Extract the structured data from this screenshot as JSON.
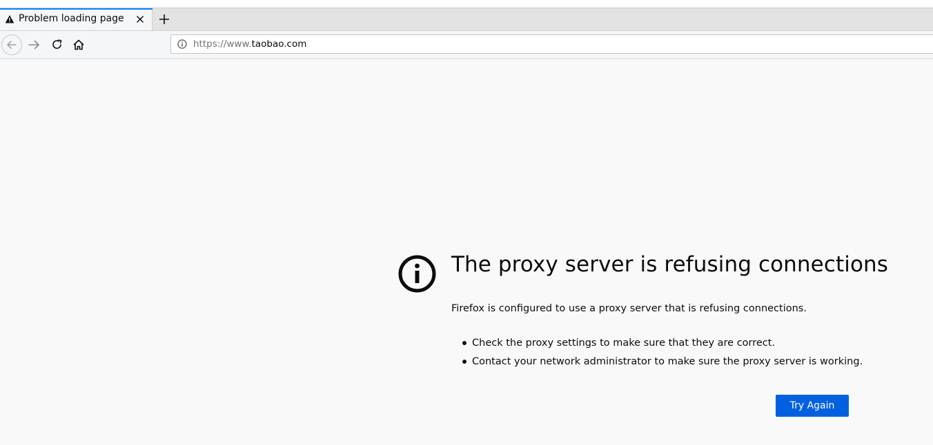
{
  "tab": {
    "title": "Problem loading page",
    "icon": "warning-icon",
    "accent_color": "#0a84ff"
  },
  "toolbar": {
    "back_icon": "back-arrow-icon",
    "forward_icon": "forward-arrow-icon",
    "reload_icon": "reload-icon",
    "home_icon": "home-icon"
  },
  "urlbar": {
    "prefix": "https://www.",
    "domain": "taobao.com",
    "info_icon": "info-icon"
  },
  "error": {
    "icon": "info-circle-icon",
    "title": "The proxy server is refusing connections",
    "description": "Firefox is configured to use a proxy server that is refusing connections.",
    "suggestions": [
      "Check the proxy settings to make sure that they are correct.",
      "Contact your network administrator to make sure the proxy server is working."
    ],
    "try_again_label": "Try Again",
    "button_color": "#0060df"
  }
}
